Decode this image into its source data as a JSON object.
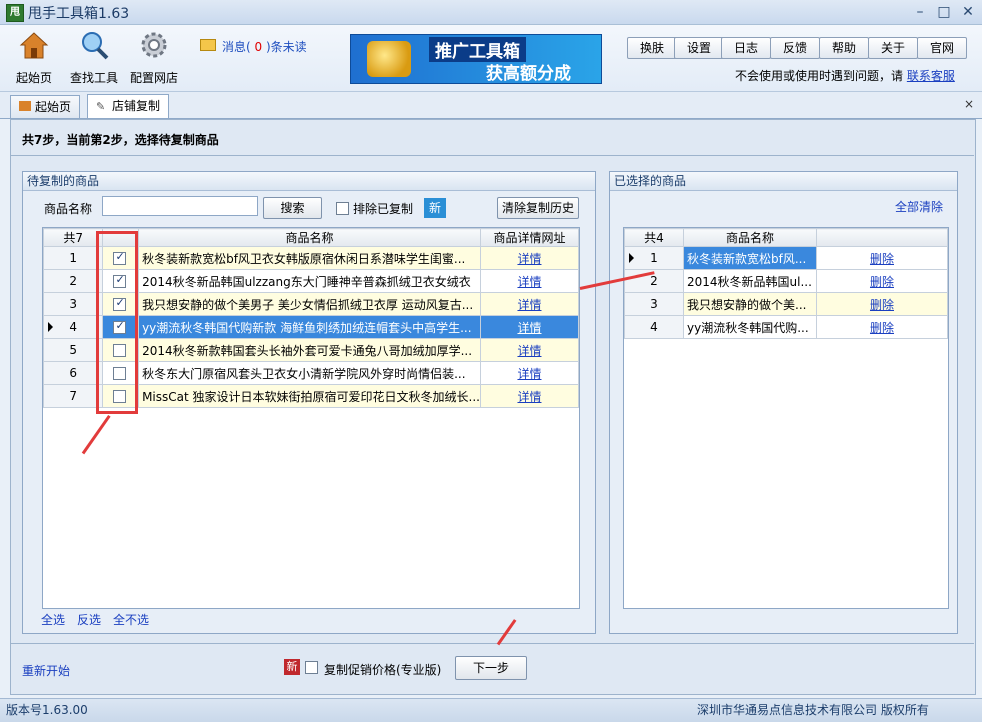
{
  "window": {
    "app_name": "甩手工具箱",
    "version": "1.63",
    "logo_text": "甩"
  },
  "toolbar": {
    "start_label": "起始页",
    "search_label": "查找工具",
    "config_label": "配置网店",
    "message_prefix": "消息(",
    "message_count": "0",
    "message_suffix": ")条未读",
    "banner_line1": "推广工具箱",
    "banner_line2": "获高额分成",
    "top_buttons": [
      "换肤",
      "设置",
      "日志",
      "反馈",
      "帮助",
      "关于",
      "官网"
    ],
    "support_text": "不会使用或使用时遇到问题，请",
    "support_link": "联系客服"
  },
  "tabs": [
    {
      "label": "起始页"
    },
    {
      "label": "店铺复制"
    }
  ],
  "step_text": "共7步，当前第2步，选择待复制商品",
  "left_panel": {
    "title": "待复制的商品",
    "name_label": "商品名称",
    "search_value": "",
    "search_button": "搜索",
    "exclude_label": "排除已复制",
    "new_badge": "新",
    "clear_history_button": "清除复制历史",
    "columns": [
      "共7",
      "",
      "商品名称",
      "商品详情网址"
    ],
    "rows": [
      {
        "num": "1",
        "checked": true,
        "name": "秋冬装新款宽松bf风卫衣女韩版原宿休闲日系潜味学生闺蜜...",
        "detail": "详情"
      },
      {
        "num": "2",
        "checked": true,
        "name": "2014秋冬新品韩国ulzzang东大门睡神辛普森抓绒卫衣女绒衣",
        "detail": "详情"
      },
      {
        "num": "3",
        "checked": true,
        "name": "我只想安静的做个美男子 美少女情侣抓绒卫衣厚 运动风复古...",
        "detail": "详情"
      },
      {
        "num": "4",
        "checked": true,
        "name": "yy潮流秋冬韩国代购新款 海鲜鱼刺绣加绒连帽套头中高学生...",
        "detail": "详情"
      },
      {
        "num": "5",
        "checked": false,
        "name": "2014秋冬新款韩国套头长袖外套可爱卡通兔八哥加绒加厚学...",
        "detail": "详情"
      },
      {
        "num": "6",
        "checked": false,
        "name": "秋冬东大门原宿风套头卫衣女小清新学院风外穿时尚情侣装...",
        "detail": "详情"
      },
      {
        "num": "7",
        "checked": false,
        "name": "MissCat 独家设计日本软妹街拍原宿可爱印花日文秋冬加绒长...",
        "detail": "详情"
      }
    ],
    "links": [
      "全选",
      "反选",
      "全不选"
    ]
  },
  "right_panel": {
    "title": "已选择的商品",
    "clear_all": "全部清除",
    "columns": [
      "共4",
      "商品名称",
      ""
    ],
    "rows": [
      {
        "num": "1",
        "name": "秋冬装新款宽松bf风...",
        "action": "删除"
      },
      {
        "num": "2",
        "name": "2014秋冬新品韩国ul...",
        "action": "删除"
      },
      {
        "num": "3",
        "name": "我只想安静的做个美...",
        "action": "删除"
      },
      {
        "num": "4",
        "name": "yy潮流秋冬韩国代购...",
        "action": "删除"
      }
    ]
  },
  "footer": {
    "restart": "重新开始",
    "new_badge": "新",
    "promo_price_label": "复制促销价格(专业版)",
    "next_button": "下一步"
  },
  "statusbar": {
    "version": "版本号1.63.00",
    "copyright": "深圳市华通易点信息技术有限公司 版权所有"
  },
  "colors": {
    "selected_row": "#3a88dd",
    "highlight_row": "#fffde0",
    "annotation": "#e23b3b",
    "link": "#1a3fc0"
  }
}
